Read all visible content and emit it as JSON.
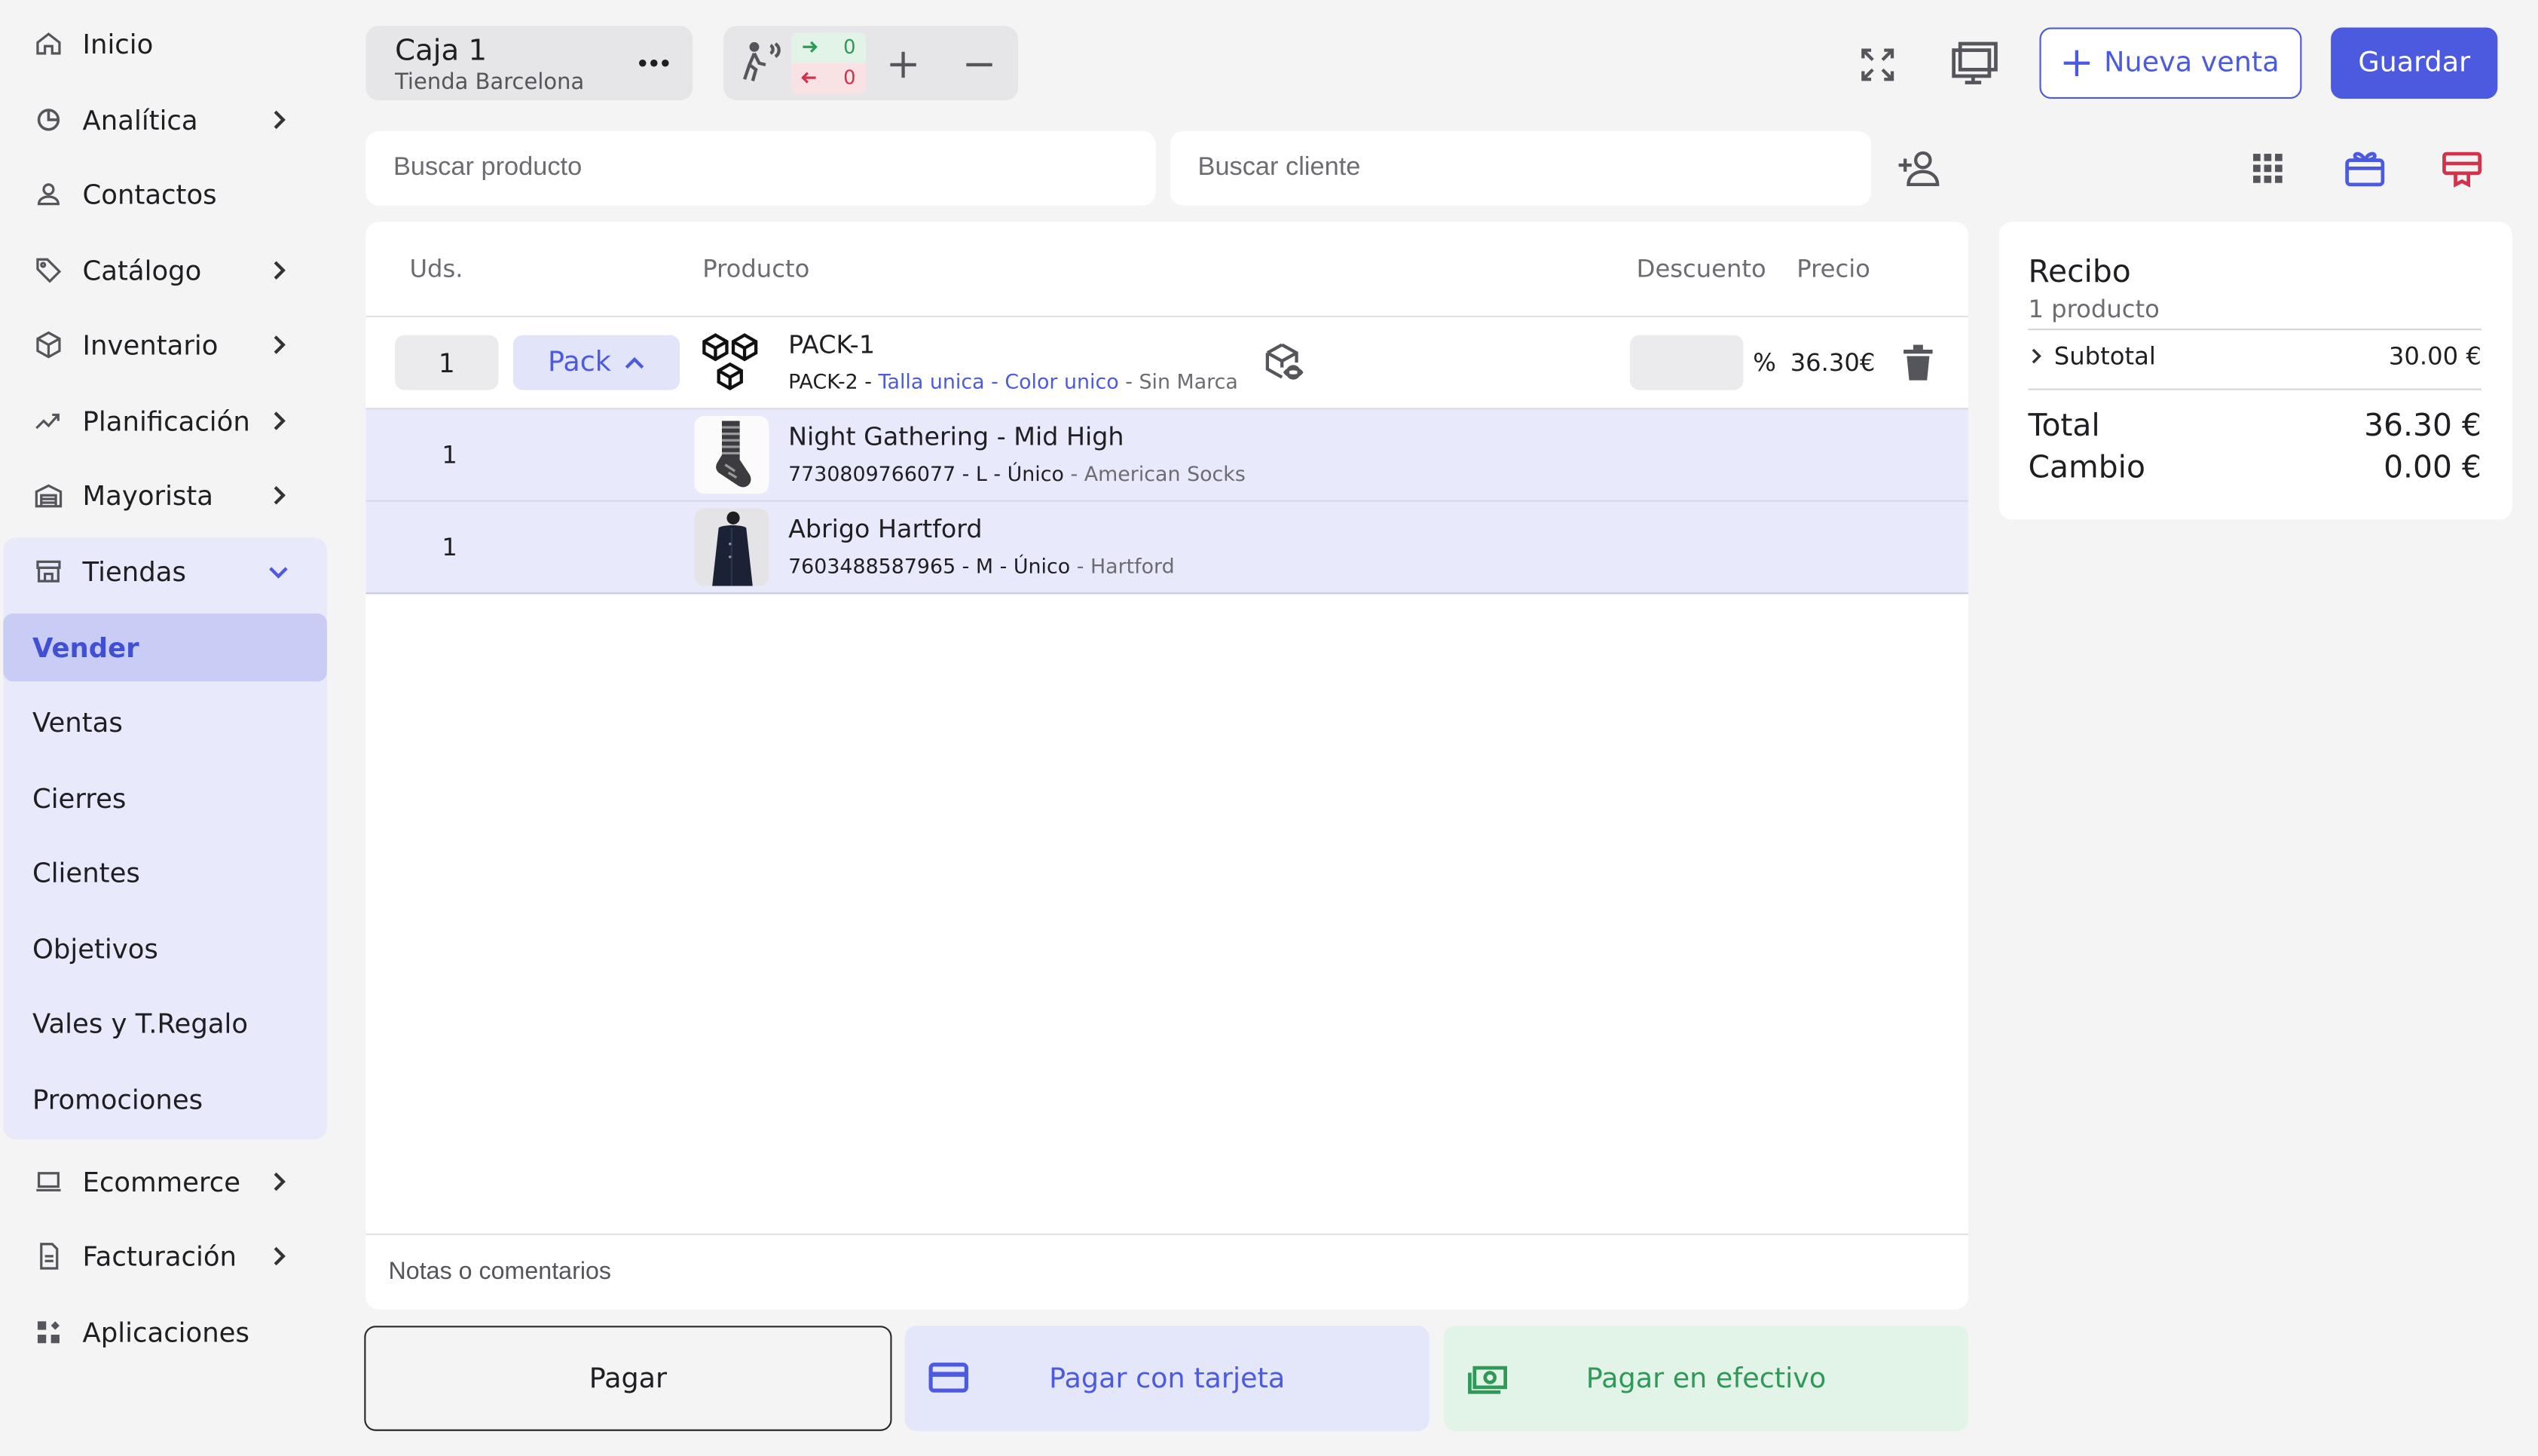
{
  "sidebar": {
    "items": [
      {
        "label": "Inicio",
        "icon": "home-icon"
      },
      {
        "label": "Analítica",
        "icon": "chart-pie-icon"
      },
      {
        "label": "Contactos",
        "icon": "user-icon"
      },
      {
        "label": "Catálogo",
        "icon": "tag-icon"
      },
      {
        "label": "Inventario",
        "icon": "box-icon"
      },
      {
        "label": "Planificación",
        "icon": "trend-icon"
      },
      {
        "label": "Mayorista",
        "icon": "warehouse-icon"
      },
      {
        "label": "Tiendas",
        "icon": "store-icon"
      }
    ],
    "tiendas_sub": [
      "Vender",
      "Ventas",
      "Cierres",
      "Clientes",
      "Objetivos",
      "Vales y T.Regalo",
      "Promociones"
    ],
    "bottom_items": [
      {
        "label": "Ecommerce",
        "icon": "laptop-icon"
      },
      {
        "label": "Facturación",
        "icon": "invoice-icon"
      },
      {
        "label": "Aplicaciones",
        "icon": "apps-icon"
      }
    ],
    "active": "Vender"
  },
  "header": {
    "register_title": "Caja 1",
    "register_store": "Tienda Barcelona",
    "traffic_in": "0",
    "traffic_out": "0",
    "new_sale_label": "Nueva venta",
    "save_label": "Guardar"
  },
  "search": {
    "product_placeholder": "Buscar producto",
    "customer_placeholder": "Buscar cliente"
  },
  "table": {
    "headers": {
      "qty": "Uds.",
      "product": "Producto",
      "discount": "Descuento",
      "price": "Precio"
    },
    "main_row": {
      "qty": "1",
      "pack_label": "Pack",
      "name": "PACK-1",
      "sku": "PACK-2",
      "size": "Talla unica",
      "color": "Color unico",
      "brand": "Sin Marca",
      "discount_unit": "%",
      "price": "36.30€"
    },
    "sub_rows": [
      {
        "qty": "1",
        "name": "Night Gathering - Mid High",
        "code": "7730809766077 - L - Único",
        "brand": "American Socks"
      },
      {
        "qty": "1",
        "name": "Abrigo Hartford",
        "code": "7603488587965 - M - Único",
        "brand": "Hartford"
      }
    ],
    "notes_placeholder": "Notas o comentarios"
  },
  "payment": {
    "pay_label": "Pagar",
    "card_label": "Pagar con tarjeta",
    "cash_label": "Pagar en efectivo"
  },
  "receipt": {
    "title": "Recibo",
    "count": "1 producto",
    "subtotal_label": "Subtotal",
    "subtotal_value": "30.00 €",
    "total_label": "Total",
    "total_value": "36.30 €",
    "change_label": "Cambio",
    "change_value": "0.00 €"
  },
  "colors": {
    "accent": "#4c5ae0",
    "cash_green": "#2f9a58",
    "alert_red": "#d2324a",
    "selection_bg": "#e8eafb"
  }
}
